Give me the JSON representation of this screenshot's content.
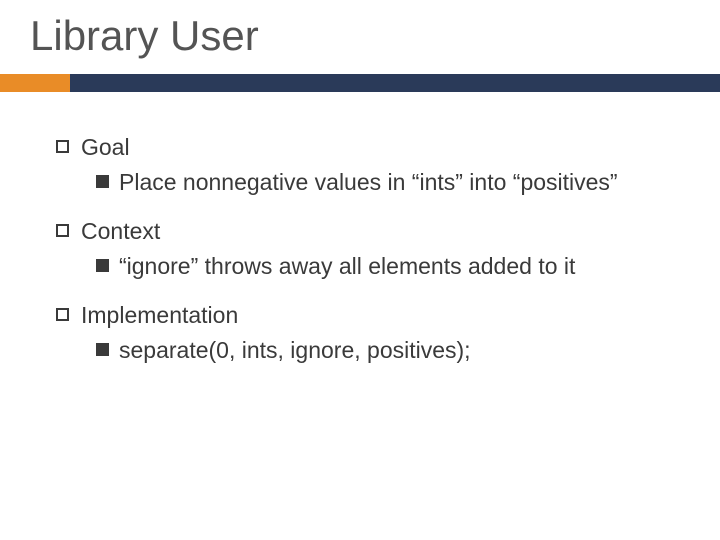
{
  "title": "Library User",
  "bullets": {
    "b1": "Goal",
    "b1_1": "Place nonnegative values in “ints” into “positives”",
    "b2": "Context",
    "b2_1": "“ignore” throws away all elements added to it",
    "b3": "Implementation",
    "b3_1": "separate(0, ints, ignore, positives);"
  }
}
